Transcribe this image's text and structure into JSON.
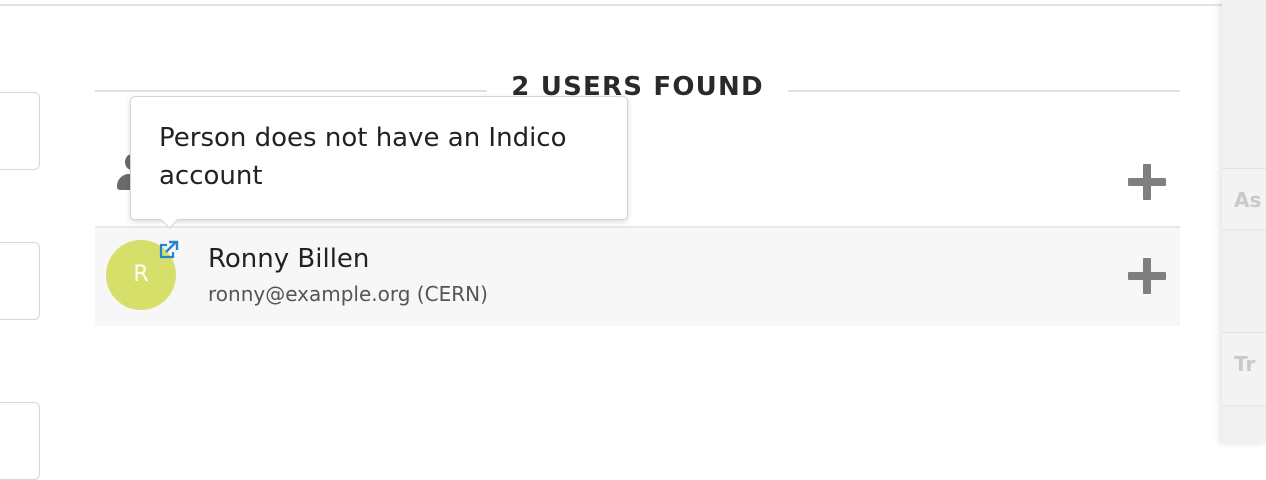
{
  "results": {
    "heading": "2 USERS FOUND",
    "users": [
      {
        "name": "",
        "email": "",
        "avatar_letter": "",
        "icon": "person-icon"
      },
      {
        "name": "Ronny Billen",
        "email": "ronny@example.org (CERN)",
        "avatar_letter": "R",
        "avatar_color": "#d6df6a",
        "icon": "external-link-icon"
      }
    ],
    "add_icon": "plus-icon"
  },
  "tooltip": {
    "text": "Person does not have an Indico account"
  },
  "colors": {
    "accent": "#2185d0",
    "add_icon": "#7f7f7f",
    "row_highlight": "#f7f7f7"
  }
}
